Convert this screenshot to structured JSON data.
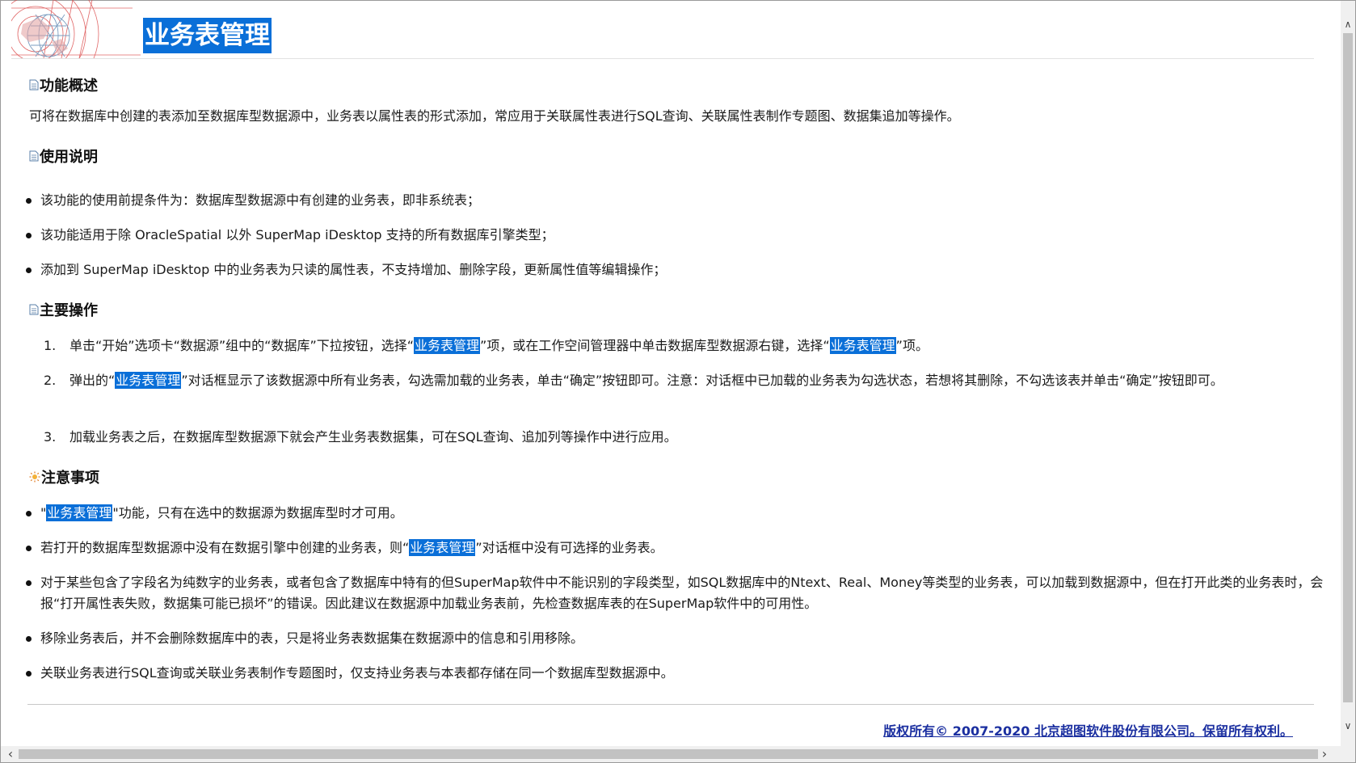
{
  "header": {
    "title": "业务表管理"
  },
  "sections": {
    "overview": {
      "heading": "功能概述",
      "text": "可将在数据库中创建的表添加至数据库型数据源中，业务表以属性表的形式添加，常应用于关联属性表进行SQL查询、关联属性表制作专题图、数据集追加等操作。"
    },
    "usage": {
      "heading": "使用说明",
      "items": [
        "该功能的使用前提条件为：数据库型数据源中有创建的业务表，即非系统表；",
        "该功能适用于除 OracleSpatial 以外 SuperMap iDesktop 支持的所有数据库引擎类型；",
        "添加到 SuperMap iDesktop 中的业务表为只读的属性表，不支持增加、删除字段，更新属性值等编辑操作；"
      ]
    },
    "operations": {
      "heading": "主要操作",
      "items": [
        {
          "num": "1.",
          "p1": "单击“开始”选项卡“数据源”组中的“数据库”下拉按钮，选择“",
          "hl1": "业务表管理",
          "p2": "”项，或在工作空间管理器中单击数据库型数据源右键，选择“",
          "hl2": "业务表管理",
          "p3": "”项。"
        },
        {
          "num": "2.",
          "p1": "弹出的“",
          "hl1": "业务表管理",
          "p2": "”对话框显示了该数据源中所有业务表，勾选需加载的业务表，单击“确定”按钮即可。注意：对话框中已加载的业务表为勾选状态，若想将其删除，不勾选该表并单击“确定”按钮即可。"
        },
        {
          "num": "3.",
          "p1": "加载业务表之后，在数据库型数据源下就会产生业务表数据集，可在SQL查询、追加列等操作中进行应用。"
        }
      ]
    },
    "notes": {
      "heading": "注意事项",
      "items": [
        {
          "p1": "\"",
          "hl1": "业务表管理",
          "p2": "\"功能，只有在选中的数据源为数据库型时才可用。"
        },
        {
          "p1": "若打开的数据库型数据源中没有在数据引擎中创建的业务表，则“",
          "hl1": "业务表管理",
          "p2": "”对话框中没有可选择的业务表。"
        },
        {
          "p1": "对于某些包含了字段名为纯数字的业务表，或者包含了数据库中特有的但SuperMap软件中不能识别的字段类型，如SQL数据库中的Ntext、Real、Money等类型的业务表，可以加载到数据源中，但在打开此类的业务表时，会报“打开属性表失败，数据集可能已损坏”的错误。因此建议在数据源中加载业务表前，先检查数据库表的在SuperMap软件中的可用性。"
        },
        {
          "p1": "移除业务表后，并不会删除数据库中的表，只是将业务表数据集在数据源中的信息和引用移除。"
        },
        {
          "p1": "关联业务表进行SQL查询或关联业务表制作专题图时，仅支持业务表与本表都存储在同一个数据库型数据源中。"
        }
      ]
    }
  },
  "footer": {
    "copyright": "版权所有© 2007-2020 北京超图软件股份有限公司。保留所有权利。"
  },
  "colors": {
    "highlight": "#0a6fd8",
    "copyright_link": "#1b2fa0",
    "logo_red": "#d94040"
  },
  "icons": {
    "section_doc": "document-icon",
    "section_note": "sun-icon"
  }
}
